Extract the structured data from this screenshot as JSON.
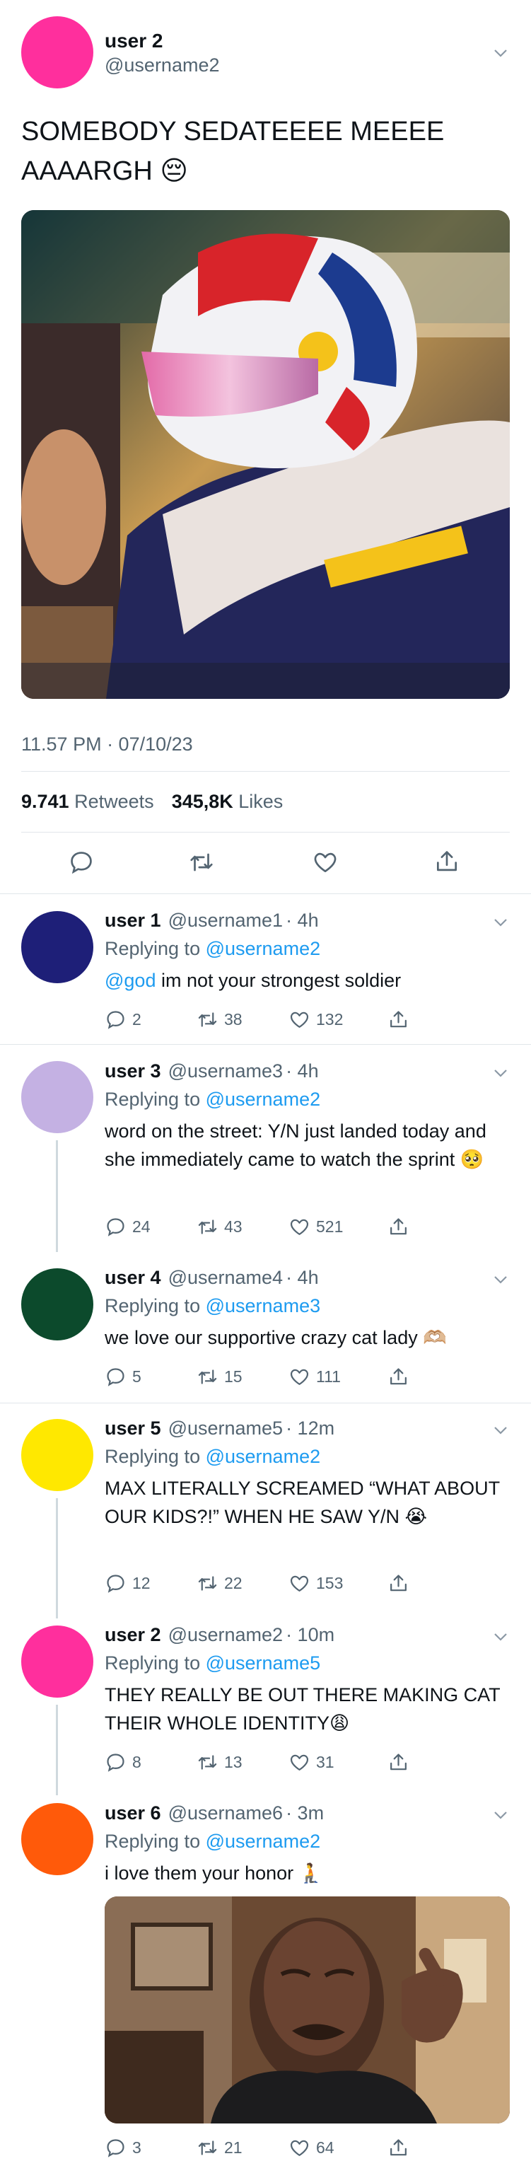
{
  "colors": {
    "accent": "#1d9bf0",
    "muted": "#536471",
    "divider": "#e1e6ea"
  },
  "main": {
    "author_name": "user 2",
    "author_handle": "@username2",
    "avatar_color": "#ff2f9d",
    "text": "SOMEBODY SEDATEEEE MEEEE AAAARGH 😔",
    "timestamp": "11.57 PM · 07/10/23",
    "retweets_count": "9.741",
    "retweets_label": "Retweets",
    "likes_count": "345,8K",
    "likes_label": "Likes",
    "actions": [
      "reply-icon",
      "retweet-icon",
      "like-icon",
      "share-icon"
    ]
  },
  "replies": [
    {
      "name": "user 1",
      "handle": "@username1",
      "time": "· 4h",
      "replying_prefix": "Replying to",
      "replying_to": "@username2",
      "mention": "@god",
      "text": " im not your strongest soldier",
      "avatar_color": "#1e1f78",
      "reply": "2",
      "retweet": "38",
      "like": "132"
    },
    {
      "name": "user 3",
      "handle": "@username3",
      "time": "· 4h",
      "replying_prefix": "Replying to",
      "replying_to": "@username2",
      "text": "word on the street: Y/N just landed today and she immediately came to watch the sprint 🥺",
      "avatar_color": "#c4b1e3",
      "reply": "24",
      "retweet": "43",
      "like": "521"
    },
    {
      "name": "user 4",
      "handle": "@username4",
      "time": "· 4h",
      "replying_prefix": "Replying to",
      "replying_to": "@username3",
      "text": "we love our supportive crazy cat lady 🫶🏼",
      "avatar_color": "#0c4a2c",
      "reply": "5",
      "retweet": "15",
      "like": "111"
    },
    {
      "name": "user 5",
      "handle": "@username5",
      "time": "· 12m",
      "replying_prefix": "Replying to",
      "replying_to": "@username2",
      "text": "MAX LITERALLY SCREAMED “WHAT ABOUT OUR KIDS?!” WHEN HE SAW Y/N 😭",
      "avatar_color": "#ffe800",
      "reply": "12",
      "retweet": "22",
      "like": "153"
    },
    {
      "name": "user 2",
      "handle": "@username2",
      "time": "· 10m",
      "replying_prefix": "Replying to",
      "replying_to": "@username5",
      "text": "THEY REALLY BE OUT THERE MAKING CAT THEIR WHOLE IDENTITY😩",
      "avatar_color": "#ff2f9d",
      "reply": "8",
      "retweet": "13",
      "like": "31"
    },
    {
      "name": "user 6",
      "handle": "@username6",
      "time": "· 3m",
      "replying_prefix": "Replying to",
      "replying_to": "@username2",
      "text": "i love them your honor 🧎",
      "avatar_color": "#ff5a0a",
      "reply": "3",
      "retweet": "21",
      "like": "64"
    }
  ]
}
